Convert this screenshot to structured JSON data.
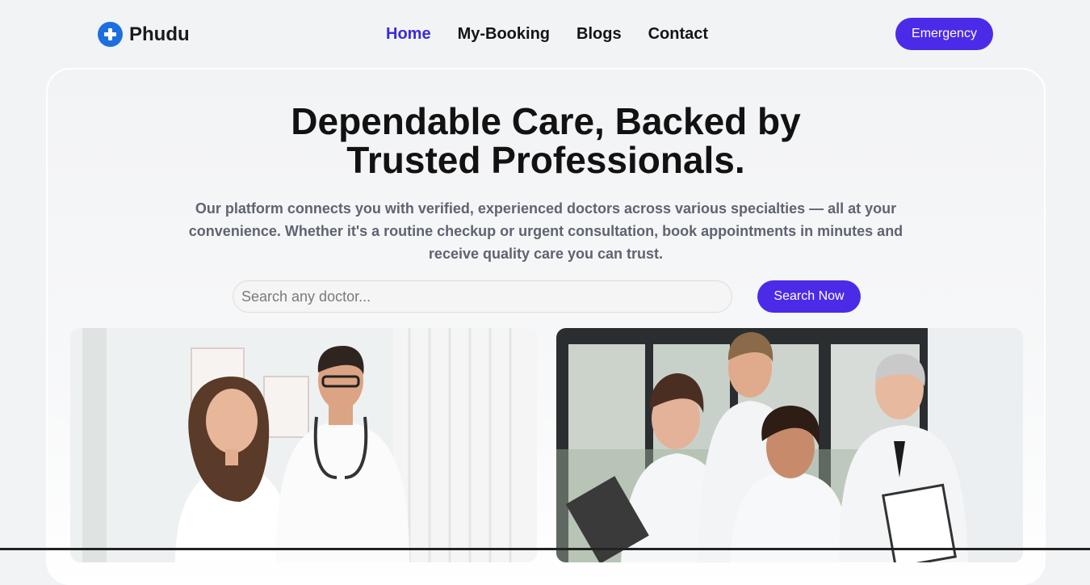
{
  "brand": {
    "name": "Phudu",
    "icon": "plus-cross-icon",
    "color": "#1d6fe0"
  },
  "nav": {
    "items": [
      {
        "label": "Home",
        "active": true
      },
      {
        "label": "My-Booking",
        "active": false
      },
      {
        "label": "Blogs",
        "active": false
      },
      {
        "label": "Contact",
        "active": false
      }
    ],
    "emergency_label": "Emergency"
  },
  "hero": {
    "title": "Dependable Care, Backed by Trusted Professionals.",
    "description": "Our platform connects you with verified, experienced doctors across various specialties — all at your convenience. Whether it's a routine checkup or urgent consultation, book appointments in minutes and receive quality care you can trust.",
    "search": {
      "placeholder": "Search any doctor...",
      "value": "",
      "button_label": "Search Now"
    }
  },
  "colors": {
    "accent": "#4b2be8",
    "active_nav": "#3b2bd6"
  }
}
